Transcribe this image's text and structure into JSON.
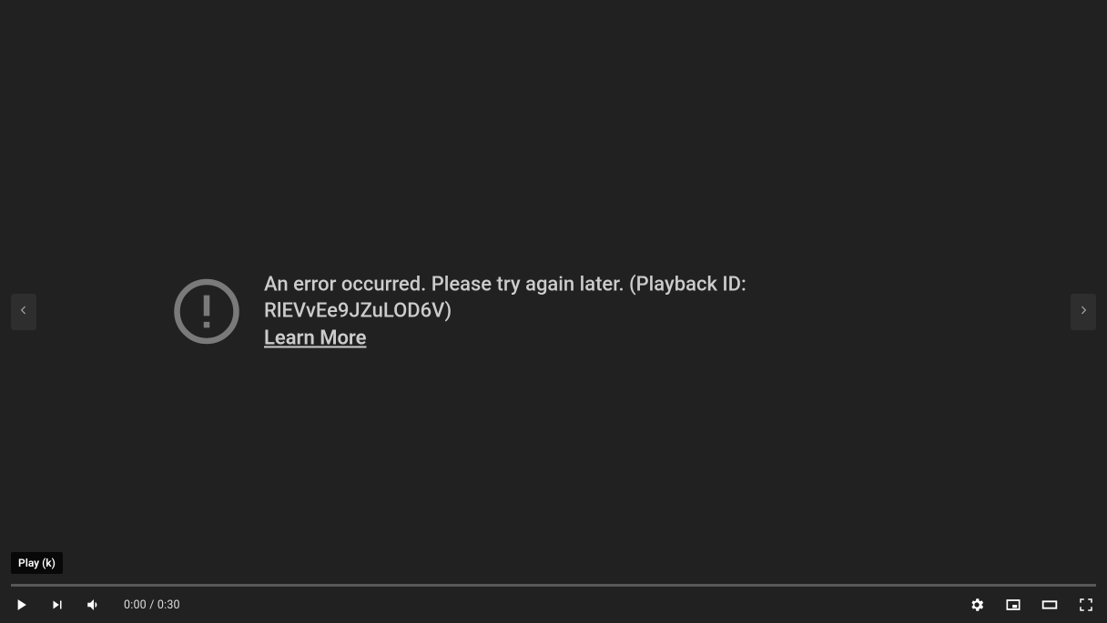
{
  "error": {
    "message": "An error occurred. Please try again later. (Playback ID: RlEVvEe9JZuLOD6V)",
    "learn_more_label": "Learn More"
  },
  "player": {
    "play_tooltip": "Play (k)",
    "current_time": "0:00",
    "time_separator": " / ",
    "duration": "0:30"
  },
  "icons": {
    "prev": "chevron-left-icon",
    "next": "chevron-right-icon",
    "play": "play-icon",
    "skip_next": "next-icon",
    "volume": "volume-icon",
    "settings": "gear-icon",
    "miniplayer": "miniplayer-icon",
    "theater": "theater-icon",
    "fullscreen": "fullscreen-icon",
    "error": "alert-circle-icon"
  }
}
